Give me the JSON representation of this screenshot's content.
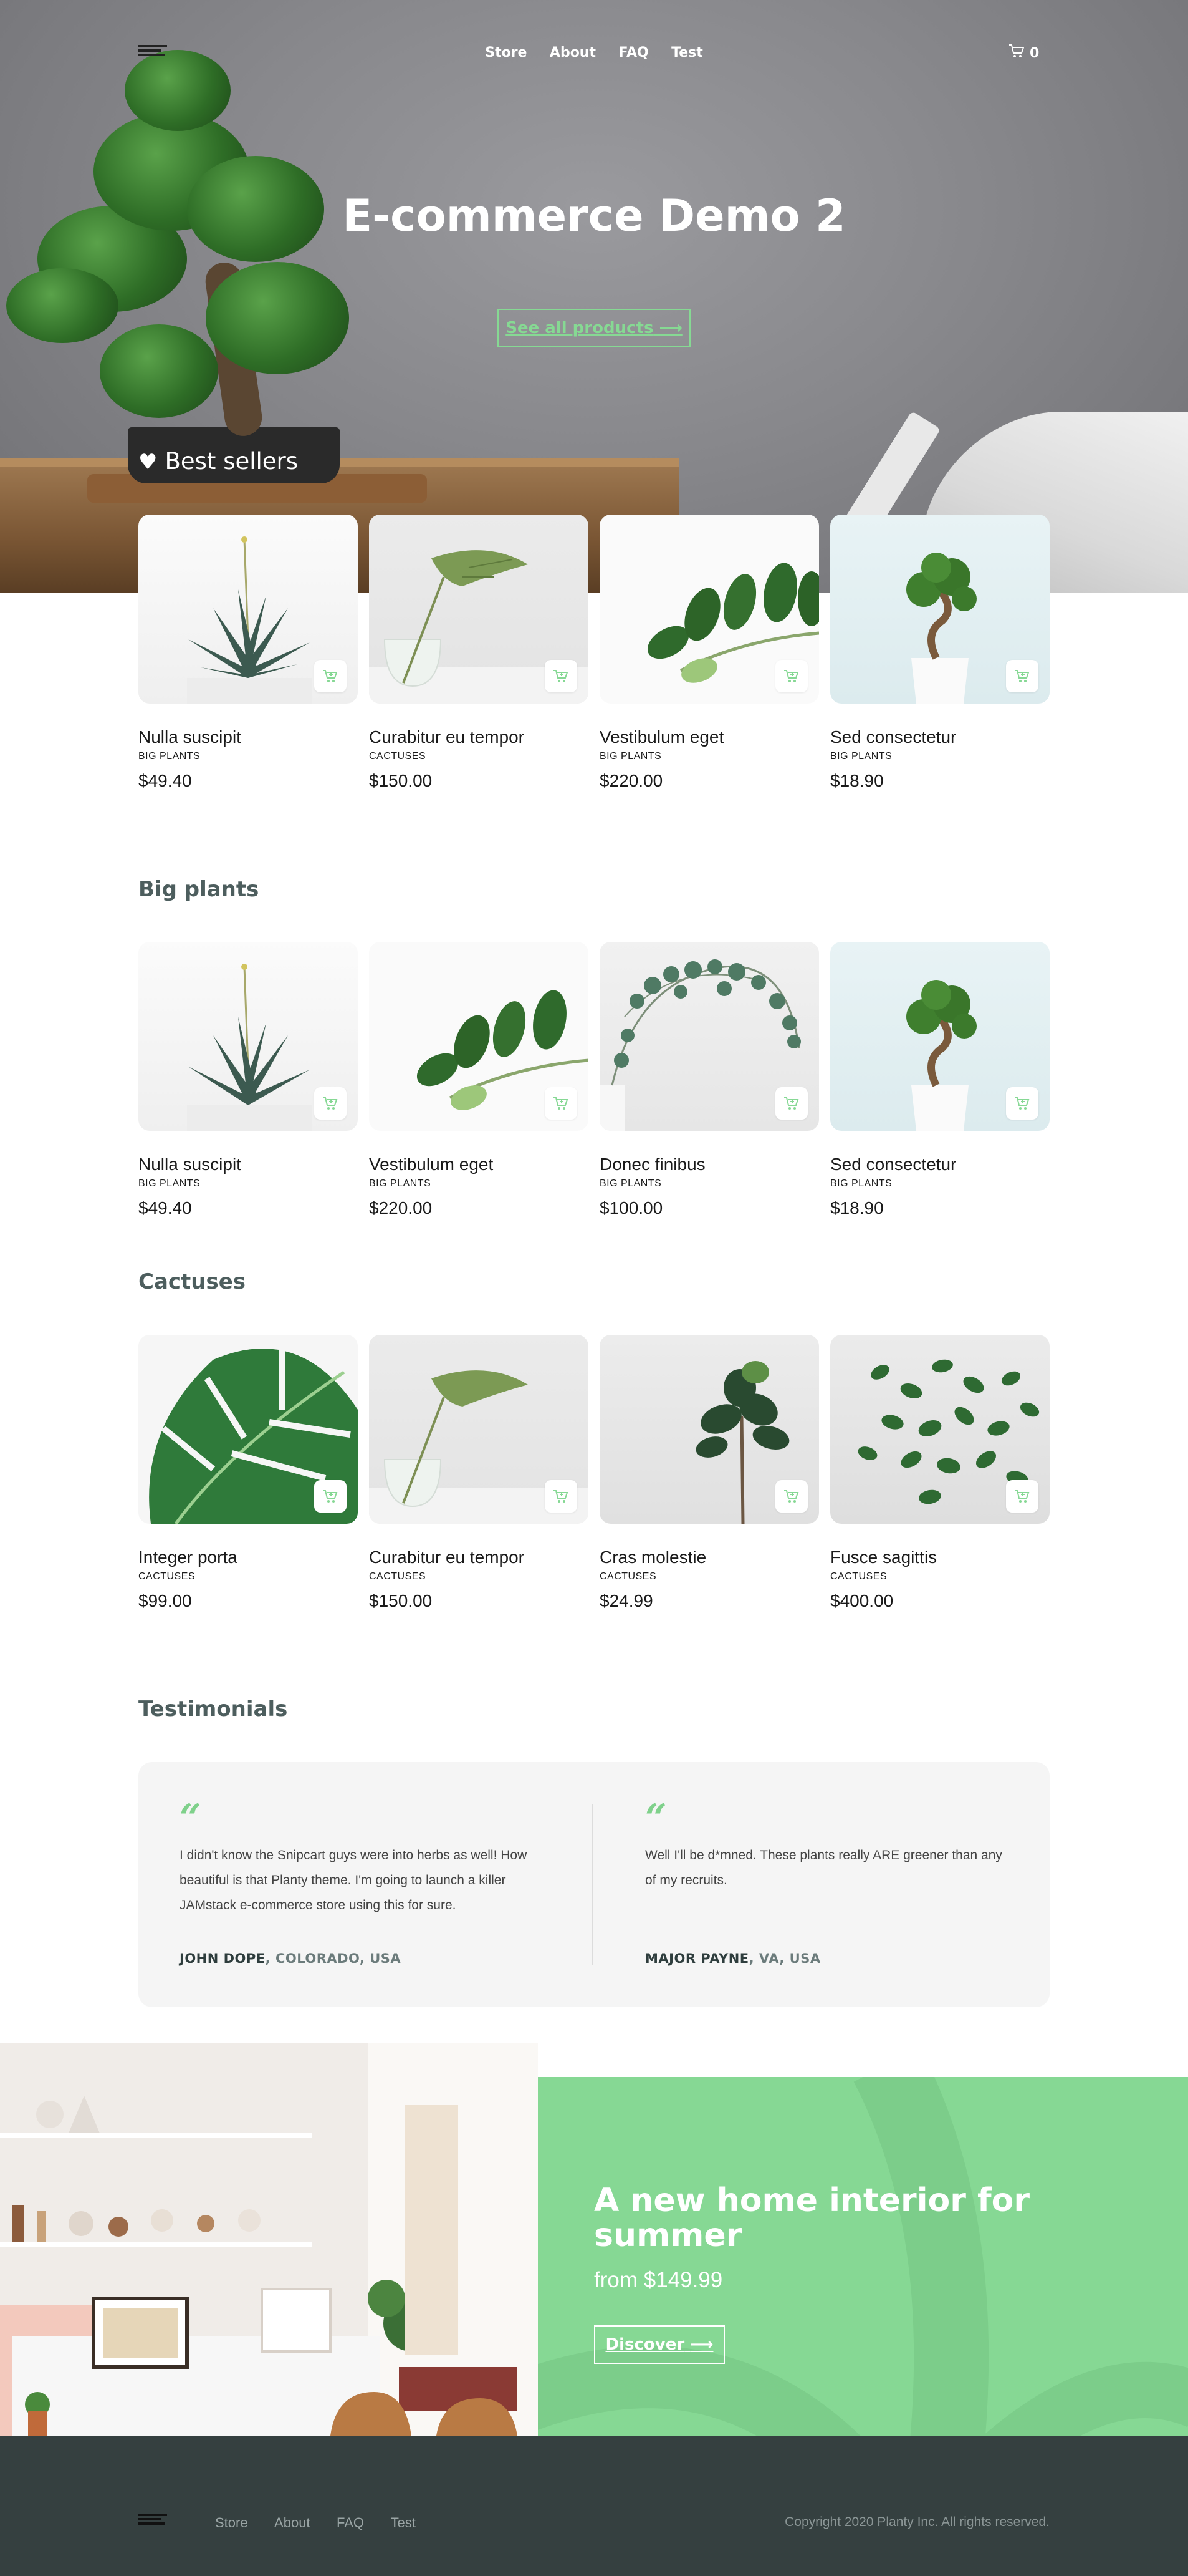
{
  "nav": {
    "links": [
      "Store",
      "About",
      "FAQ",
      "Test"
    ],
    "cart_count": "0"
  },
  "hero": {
    "title": "E-commerce Demo 2",
    "button": "See all products"
  },
  "best_sellers": {
    "title": "Best sellers",
    "products": [
      {
        "name": "Nulla suscipit",
        "category": "BIG PLANTS",
        "price": "$49.40"
      },
      {
        "name": "Curabitur eu tempor",
        "category": "CACTUSES",
        "price": "$150.00"
      },
      {
        "name": "Vestibulum eget",
        "category": "BIG PLANTS",
        "price": "$220.00"
      },
      {
        "name": "Sed consectetur",
        "category": "BIG PLANTS",
        "price": "$18.90"
      }
    ]
  },
  "big_plants": {
    "title": "Big plants",
    "products": [
      {
        "name": "Nulla suscipit",
        "category": "BIG PLANTS",
        "price": "$49.40"
      },
      {
        "name": "Vestibulum eget",
        "category": "BIG PLANTS",
        "price": "$220.00"
      },
      {
        "name": "Donec finibus",
        "category": "BIG PLANTS",
        "price": "$100.00"
      },
      {
        "name": "Sed consectetur",
        "category": "BIG PLANTS",
        "price": "$18.90"
      }
    ]
  },
  "cactuses": {
    "title": "Cactuses",
    "products": [
      {
        "name": "Integer porta",
        "category": "CACTUSES",
        "price": "$99.00"
      },
      {
        "name": "Curabitur eu tempor",
        "category": "CACTUSES",
        "price": "$150.00"
      },
      {
        "name": "Cras molestie",
        "category": "CACTUSES",
        "price": "$24.99"
      },
      {
        "name": "Fusce sagittis",
        "category": "CACTUSES",
        "price": "$400.00"
      }
    ]
  },
  "testimonials": {
    "title": "Testimonials",
    "items": [
      {
        "quote": "I didn't know the Snipcart guys were into herbs as well! How beautiful is that Planty theme. I'm going to launch a killer JAMstack e-commerce store using this for sure.",
        "author": "JOHN DOPE",
        "location": ", COLORADO, USA"
      },
      {
        "quote": "Well I'll be d*mned. These plants really ARE greener than any of my recruits.",
        "author": "MAJOR PAYNE",
        "location": ", VA, USA"
      }
    ]
  },
  "promo": {
    "title": "A new home interior for summer",
    "subtitle": "from $149.99",
    "button": "Discover"
  },
  "footer": {
    "links": [
      "Store",
      "About",
      "FAQ",
      "Test"
    ],
    "copyright": "Copyright 2020 Planty Inc. All rights reserved."
  },
  "colors": {
    "accent": "#86d894",
    "footer_bg": "#354040",
    "section_title": "#4d5e5e"
  }
}
